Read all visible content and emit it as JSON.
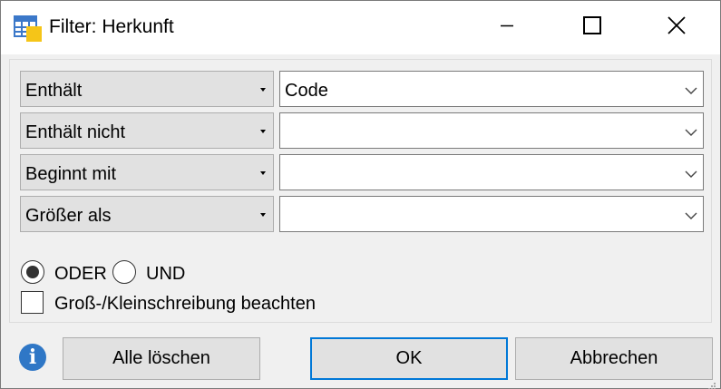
{
  "window": {
    "title": "Filter: Herkunft"
  },
  "icons": {
    "app": "table-note-icon",
    "minimize": "minimize-icon",
    "maximize": "maximize-icon",
    "close": "close-icon",
    "info": "info-icon",
    "info_glyph": "i"
  },
  "filters": [
    {
      "operator": "Enthält",
      "value": "Code"
    },
    {
      "operator": "Enthält nicht",
      "value": ""
    },
    {
      "operator": "Beginnt mit",
      "value": ""
    },
    {
      "operator": "Größer als",
      "value": ""
    }
  ],
  "logic": {
    "oder_label": "ODER",
    "und_label": "UND",
    "selected": "ODER"
  },
  "case_sensitive": {
    "label": "Groß-/Kleinschreibung beachten",
    "checked": false
  },
  "buttons": {
    "clear_all": "Alle löschen",
    "ok": "OK",
    "cancel": "Abbrechen"
  },
  "colors": {
    "accent": "#0078d7",
    "info": "#2f77c6",
    "button_face": "#e1e1e1",
    "dialog_bg": "#f0f0f0"
  }
}
